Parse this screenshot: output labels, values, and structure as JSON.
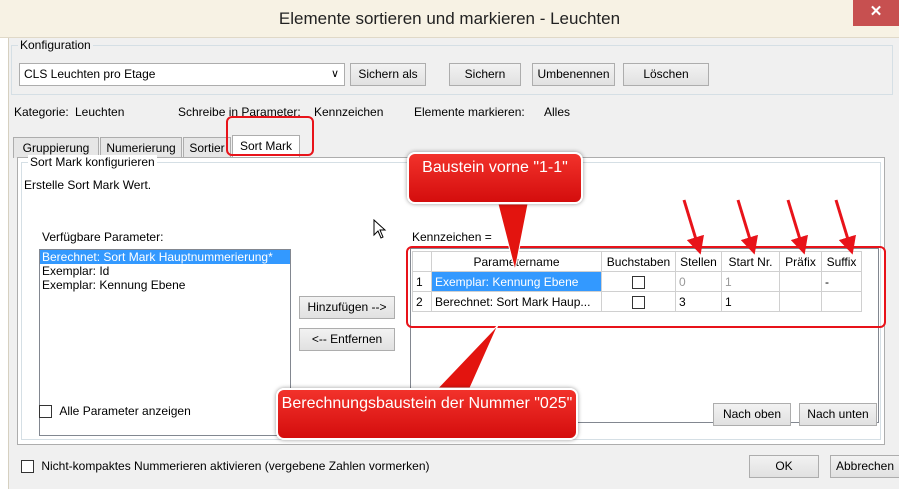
{
  "window": {
    "title": "Elemente sortieren und markieren - Leuchten",
    "close_label": "✕"
  },
  "config": {
    "legend": "Konfiguration",
    "selected": "CLS Leuchten pro Etage",
    "save_as": "Sichern als",
    "save": "Sichern",
    "rename": "Umbenennen",
    "delete": "Löschen"
  },
  "info": {
    "category_label": "Kategorie:",
    "category_value": "Leuchten",
    "write_label": "Schreibe in Parameter:",
    "write_value": "Kennzeichen",
    "mark_label": "Elemente markieren:",
    "mark_value": "Alles"
  },
  "tabs": [
    "Gruppierung",
    "Numerierung",
    "Sortier",
    "Sort Mark"
  ],
  "panel": {
    "legend": "Sort Mark konfigurieren",
    "description": "Erstelle Sort Mark Wert.",
    "available_label": "Verfügbare Parameter:",
    "available_items": [
      "Berechnet: Sort Mark Hauptnummerierung*",
      "Exemplar: Id",
      "Exemplar: Kennung Ebene"
    ],
    "add_button": "Hinzufügen -->",
    "remove_button": "<-- Entfernen",
    "kennzeichen_label": "Kennzeichen =",
    "show_all_label": "Alle Parameter anzeigen",
    "move_up": "Nach oben",
    "move_down": "Nach unten"
  },
  "grid": {
    "columns": [
      "",
      "Parametername",
      "Buchstaben",
      "Stellen",
      "Start Nr.",
      "Präfix",
      "Suffix"
    ],
    "rows": [
      {
        "num": "1",
        "name": "Exemplar: Kennung Ebene",
        "stellen": "0",
        "start": "1",
        "prefix": "",
        "suffix": "-"
      },
      {
        "num": "2",
        "name": "Berechnet: Sort Mark Haup...",
        "stellen": "3",
        "start": "1",
        "prefix": "",
        "suffix": ""
      }
    ]
  },
  "footer": {
    "compact_label": "Nicht-kompaktes Nummerieren aktivieren (vergebene Zahlen vormerken)",
    "ok": "OK",
    "cancel": "Abbrechen"
  },
  "annotations": {
    "callout_top": "Baustein vorne \"1-1\"",
    "callout_bottom": "Berechnungsbaustein der Nummer \"025\"",
    "accent_color": "#e8131a"
  }
}
